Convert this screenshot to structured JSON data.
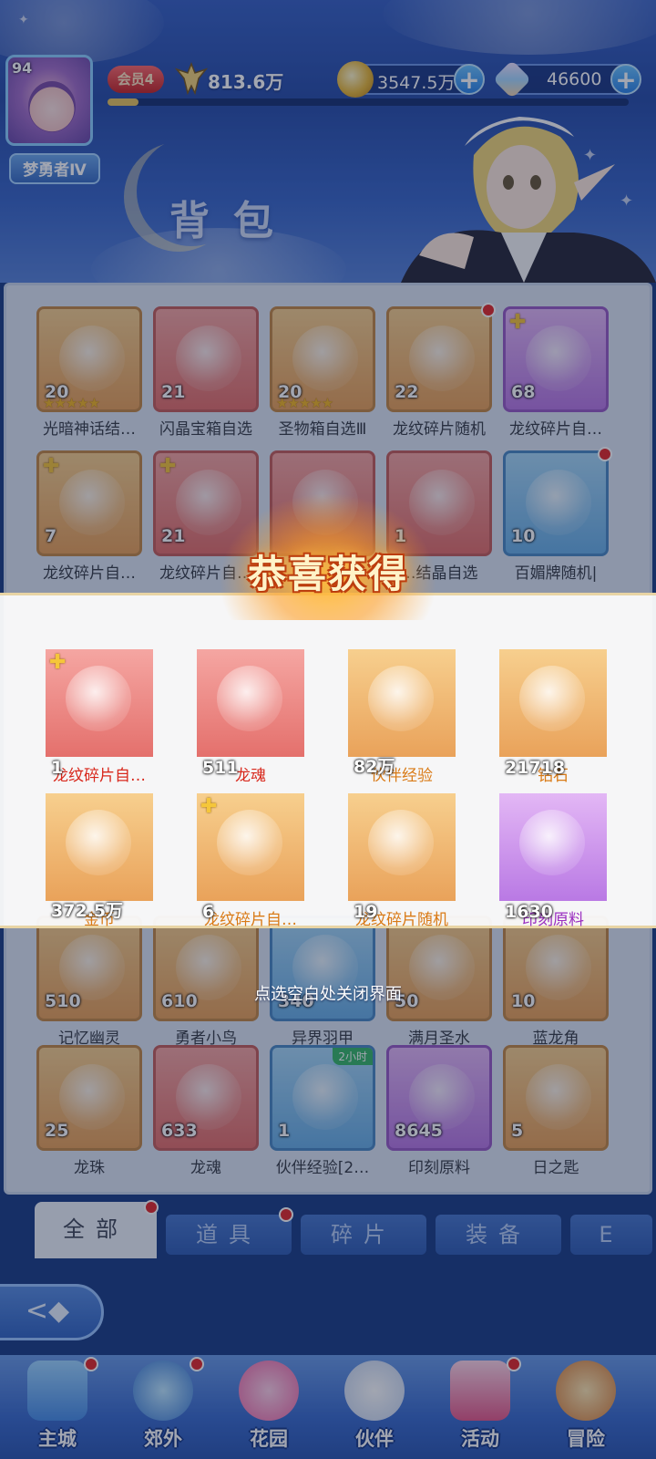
{
  "header": {
    "player_level": "94",
    "player_name": "梦勇者Ⅳ",
    "vip_label": "会员4",
    "combat_power": "813.6万",
    "exp_progress": 0.06,
    "gold_amount": "3547.5万",
    "diamond_amount": "46600",
    "plus_label": "+"
  },
  "page_title": "背包",
  "inventory": [
    {
      "count": "20",
      "label": "光暗神话结…",
      "color": "orange",
      "stars": "★★★★★",
      "puzzle": false,
      "dot": false
    },
    {
      "count": "21",
      "label": "闪晶宝箱自选",
      "color": "red",
      "stars": "",
      "puzzle": false,
      "dot": false
    },
    {
      "count": "20",
      "label": "圣物箱自选Ⅲ",
      "color": "orange",
      "stars": "★★★★★",
      "puzzle": false,
      "dot": false
    },
    {
      "count": "22",
      "label": "龙纹碎片随机",
      "color": "orange",
      "stars": "",
      "puzzle": false,
      "dot": true
    },
    {
      "count": "68",
      "label": "龙纹碎片自…",
      "color": "purple",
      "stars": "",
      "puzzle": true,
      "dot": false
    },
    {
      "count": "7",
      "label": "龙纹碎片自…",
      "color": "orange",
      "stars": "",
      "puzzle": true,
      "dot": false
    },
    {
      "count": "21",
      "label": "龙纹碎片自…",
      "color": "red",
      "stars": "",
      "puzzle": true,
      "dot": false
    },
    {
      "count": "",
      "label": "",
      "color": "red",
      "stars": "",
      "puzzle": false,
      "dot": false
    },
    {
      "count": "1",
      "label": "…结晶自选",
      "color": "red",
      "stars": "",
      "puzzle": false,
      "dot": false
    },
    {
      "count": "10",
      "label": "百媚牌随机|",
      "color": "blue",
      "stars": "",
      "puzzle": false,
      "dot": true
    },
    {
      "count": "510",
      "label": "记忆幽灵",
      "color": "orange",
      "stars": "",
      "puzzle": false,
      "dot": false
    },
    {
      "count": "610",
      "label": "勇者小鸟",
      "color": "orange",
      "stars": "",
      "puzzle": false,
      "dot": false
    },
    {
      "count": "340",
      "label": "异界羽甲",
      "color": "blue",
      "stars": "",
      "puzzle": false,
      "dot": false
    },
    {
      "count": "50",
      "label": "满月圣水",
      "color": "orange",
      "stars": "",
      "puzzle": false,
      "dot": false
    },
    {
      "count": "10",
      "label": "蓝龙角",
      "color": "orange",
      "stars": "",
      "puzzle": false,
      "dot": false
    },
    {
      "count": "25",
      "label": "龙珠",
      "color": "orange",
      "stars": "",
      "puzzle": false,
      "dot": false
    },
    {
      "count": "633",
      "label": "龙魂",
      "color": "red",
      "stars": "",
      "puzzle": false,
      "dot": false
    },
    {
      "count": "1",
      "label": "伙伴经验[2…",
      "color": "blue",
      "stars": "",
      "puzzle": false,
      "dot": false,
      "tag": "2小时"
    },
    {
      "count": "8645",
      "label": "印刻原料",
      "color": "purple",
      "stars": "",
      "puzzle": false,
      "dot": false
    },
    {
      "count": "5",
      "label": "日之匙",
      "color": "orange",
      "stars": "",
      "puzzle": false,
      "dot": false
    }
  ],
  "reward_popup": {
    "title": "恭喜获得",
    "close_hint": "点选空白处关闭界面",
    "items": [
      {
        "count": "1",
        "label": "龙纹碎片自…",
        "color": "red",
        "label_color": "red",
        "puzzle": true
      },
      {
        "count": "511",
        "label": "龙魂",
        "color": "red",
        "label_color": "red",
        "puzzle": false
      },
      {
        "count": "82万",
        "label": "伙伴经验",
        "color": "orange",
        "label_color": "orange",
        "puzzle": false
      },
      {
        "count": "21718",
        "label": "钻石",
        "color": "orange",
        "label_color": "orange",
        "puzzle": false
      },
      {
        "count": "372.5万",
        "label": "金币",
        "color": "orange",
        "label_color": "orange",
        "puzzle": false
      },
      {
        "count": "6",
        "label": "龙纹碎片自…",
        "color": "orange",
        "label_color": "orange",
        "puzzle": true
      },
      {
        "count": "19",
        "label": "龙纹碎片随机",
        "color": "orange",
        "label_color": "orange",
        "puzzle": false
      },
      {
        "count": "1630",
        "label": "印刻原料",
        "color": "purple",
        "label_color": "purple",
        "puzzle": false
      }
    ]
  },
  "tabs": [
    {
      "label": "全部",
      "active": true,
      "dot": true
    },
    {
      "label": "道具",
      "active": false,
      "dot": true
    },
    {
      "label": "碎片",
      "active": false,
      "dot": false
    },
    {
      "label": "装备",
      "active": false,
      "dot": false
    },
    {
      "label": "E",
      "active": false,
      "dot": false
    }
  ],
  "back_label": "<◆",
  "bottom_nav": [
    {
      "label": "主城",
      "dot": true,
      "icon": "castle-icon"
    },
    {
      "label": "郊外",
      "dot": true,
      "icon": "portal-icon"
    },
    {
      "label": "花园",
      "dot": false,
      "icon": "heart-icon"
    },
    {
      "label": "伙伴",
      "dot": false,
      "icon": "companion-icon"
    },
    {
      "label": "活动",
      "dot": true,
      "icon": "gift-icon"
    },
    {
      "label": "冒险",
      "dot": false,
      "icon": "sword-icon"
    }
  ]
}
